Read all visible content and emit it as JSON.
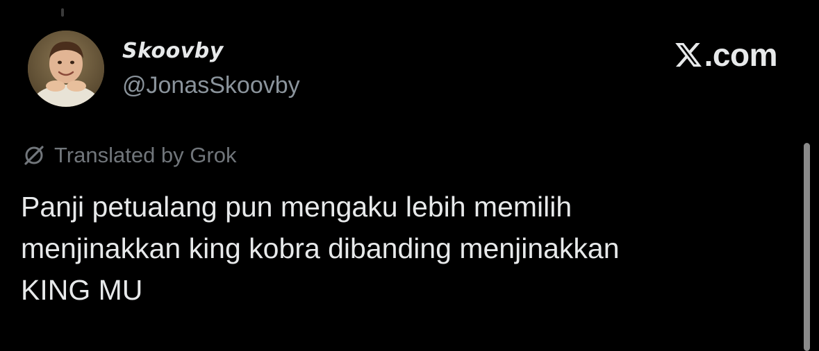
{
  "tweet": {
    "display_name": "Skoovby",
    "handle": "@JonasSkoovby",
    "translation_label": "Translated by Grok",
    "text_lines": [
      "Panji petualang pun mengaku lebih memilih",
      "menjinakkan king kobra dibanding menjinakkan",
      "KING MU"
    ]
  },
  "brand": {
    "icon": "x-logo-icon",
    "domain": ".com"
  },
  "icons": {
    "translate": "grok-icon",
    "avatar": "avatar"
  },
  "colors": {
    "background": "#000000",
    "primary_text": "#e7e9ea",
    "secondary_text": "#71767b",
    "handle_text": "#8b949c"
  }
}
